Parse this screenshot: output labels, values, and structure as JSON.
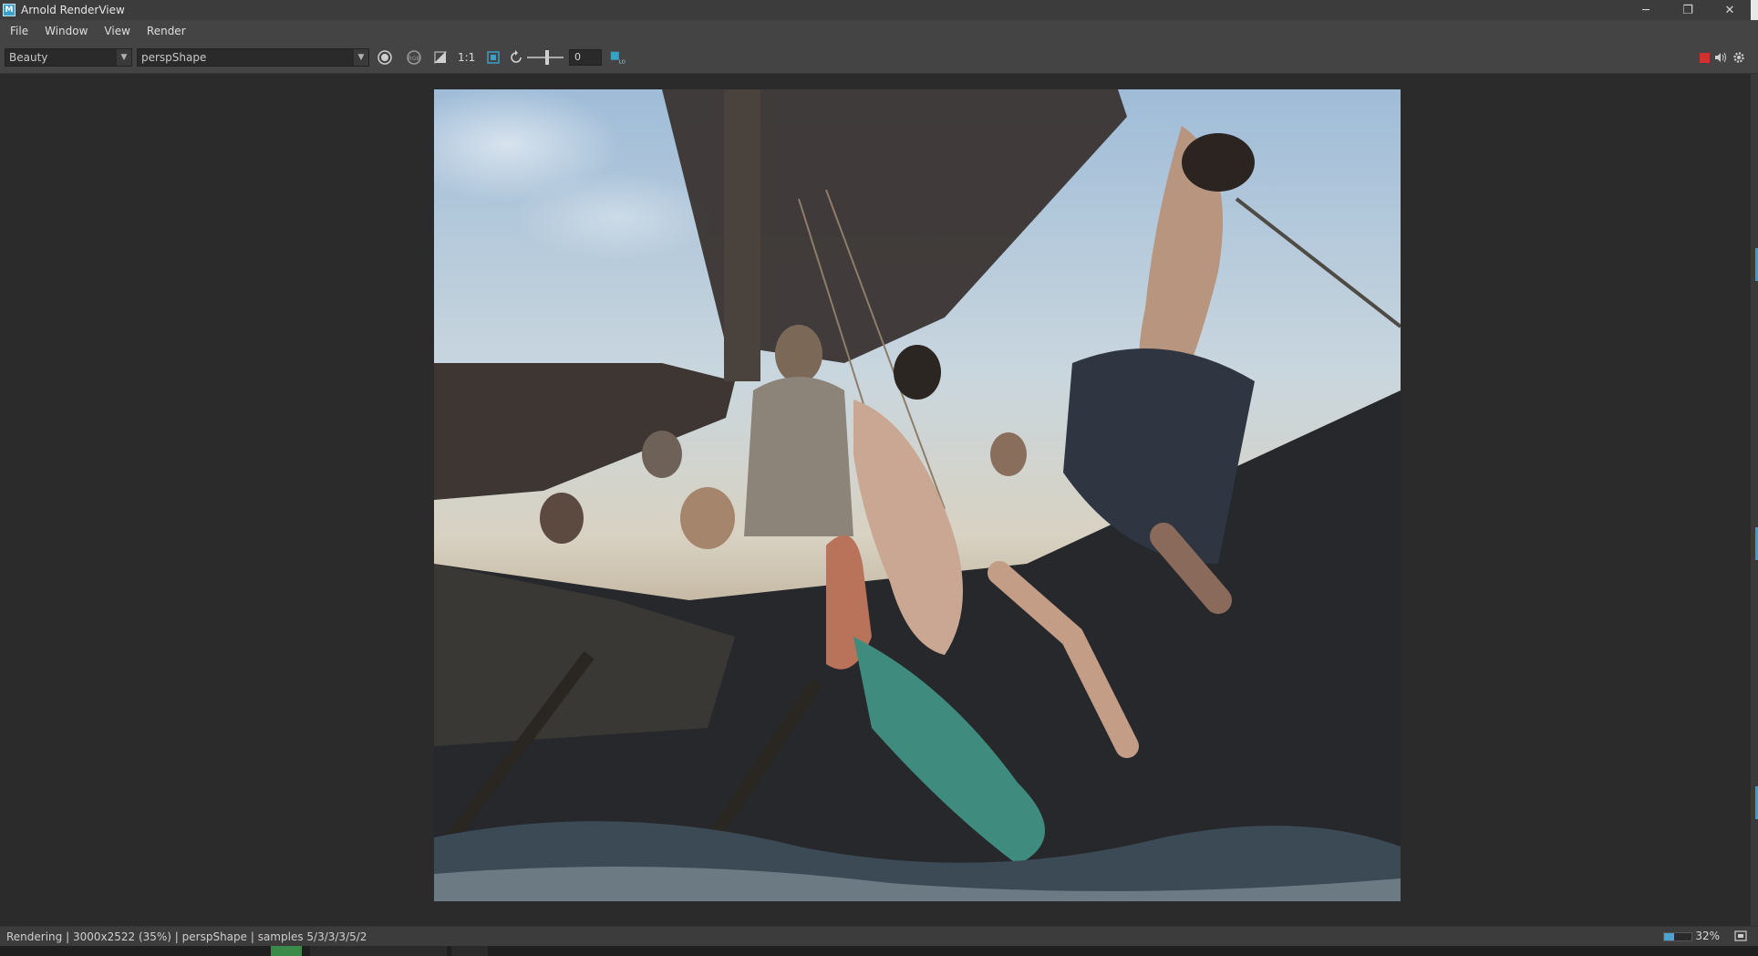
{
  "window": {
    "title": "Arnold RenderView",
    "app_icon_glyph": "M",
    "controls": {
      "minimize": "─",
      "restore": "❐",
      "close": "✕"
    }
  },
  "menu": [
    "File",
    "Window",
    "View",
    "Render"
  ],
  "toolbar": {
    "aov_dropdown": "Beauty",
    "camera_dropdown": "perspShape",
    "ratio_label": "1:1",
    "exposure_value": "0",
    "icons": [
      "render-region-icon",
      "rgb-channel-icon",
      "contrast-icon",
      "fit-frame-icon",
      "refresh-icon",
      "log-icon",
      "stop-render-icon",
      "sound-icon",
      "settings-icon"
    ]
  },
  "status": {
    "text": "Rendering | 3000x2522 (35%) | perspShape | samples 5/3/3/3/5/2",
    "zoom": "32%",
    "progress": 0.35
  },
  "colors": {
    "accent": "#3aa0c8",
    "stop_red": "#d03030",
    "background": "#2b2b2b",
    "panel": "#444444"
  }
}
